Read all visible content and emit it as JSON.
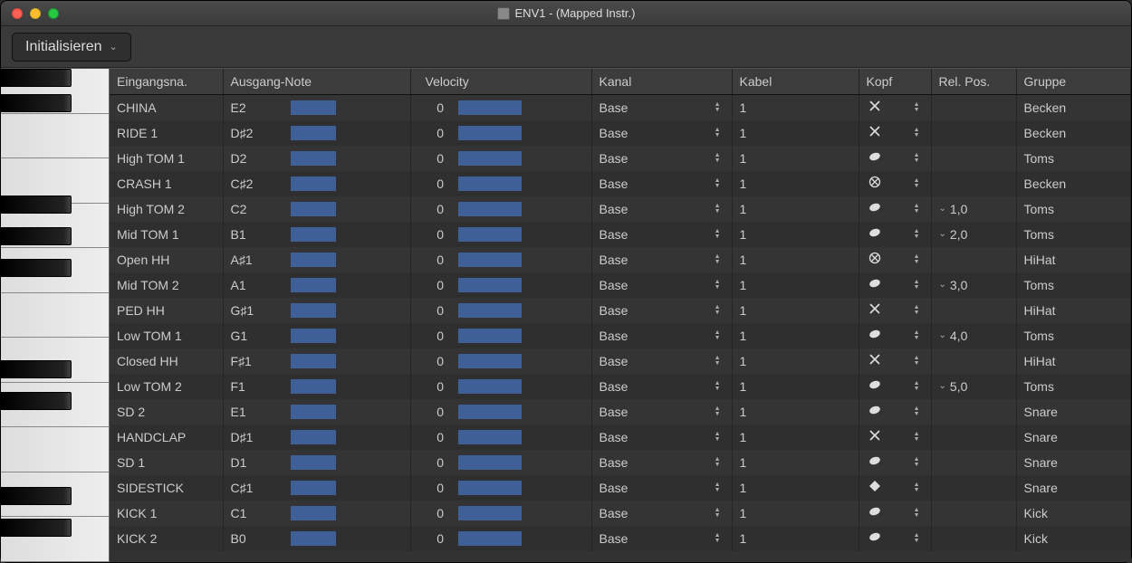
{
  "window": {
    "title": "ENV1 - (Mapped Instr.)"
  },
  "toolbar": {
    "init_label": "Initialisieren"
  },
  "columns": {
    "name": "Eingangsna.",
    "outnote": "Ausgang-Note",
    "velocity": "Velocity",
    "kanal": "Kanal",
    "kabel": "Kabel",
    "kopf": "Kopf",
    "relpos": "Rel. Pos.",
    "gruppe": "Gruppe"
  },
  "rows": [
    {
      "name": "CHINA",
      "note": "E2",
      "vel": "0",
      "kanal": "Base",
      "kabel": "1",
      "kopf": "x",
      "rel": "",
      "gruppe": "Becken"
    },
    {
      "name": "RIDE 1",
      "note": "D♯2",
      "vel": "0",
      "kanal": "Base",
      "kabel": "1",
      "kopf": "x",
      "rel": "",
      "gruppe": "Becken"
    },
    {
      "name": "High TOM 1",
      "note": "D2",
      "vel": "0",
      "kanal": "Base",
      "kabel": "1",
      "kopf": "oval",
      "rel": "",
      "gruppe": "Toms"
    },
    {
      "name": "CRASH 1",
      "note": "C♯2",
      "vel": "0",
      "kanal": "Base",
      "kabel": "1",
      "kopf": "xcircle",
      "rel": "",
      "gruppe": "Becken"
    },
    {
      "name": "High TOM 2",
      "note": "C2",
      "vel": "0",
      "kanal": "Base",
      "kabel": "1",
      "kopf": "oval",
      "rel": "1,0",
      "gruppe": "Toms"
    },
    {
      "name": "Mid TOM 1",
      "note": "B1",
      "vel": "0",
      "kanal": "Base",
      "kabel": "1",
      "kopf": "oval",
      "rel": "2,0",
      "gruppe": "Toms"
    },
    {
      "name": "Open HH",
      "note": "A♯1",
      "vel": "0",
      "kanal": "Base",
      "kabel": "1",
      "kopf": "xcircle",
      "rel": "",
      "gruppe": "HiHat"
    },
    {
      "name": "Mid TOM 2",
      "note": "A1",
      "vel": "0",
      "kanal": "Base",
      "kabel": "1",
      "kopf": "oval",
      "rel": "3,0",
      "gruppe": "Toms"
    },
    {
      "name": "PED HH",
      "note": "G♯1",
      "vel": "0",
      "kanal": "Base",
      "kabel": "1",
      "kopf": "x",
      "rel": "",
      "gruppe": "HiHat"
    },
    {
      "name": "Low TOM 1",
      "note": "G1",
      "vel": "0",
      "kanal": "Base",
      "kabel": "1",
      "kopf": "oval",
      "rel": "4,0",
      "gruppe": "Toms"
    },
    {
      "name": "Closed HH",
      "note": "F♯1",
      "vel": "0",
      "kanal": "Base",
      "kabel": "1",
      "kopf": "x",
      "rel": "",
      "gruppe": "HiHat"
    },
    {
      "name": "Low TOM 2",
      "note": "F1",
      "vel": "0",
      "kanal": "Base",
      "kabel": "1",
      "kopf": "oval",
      "rel": "5,0",
      "gruppe": "Toms"
    },
    {
      "name": "SD 2",
      "note": "E1",
      "vel": "0",
      "kanal": "Base",
      "kabel": "1",
      "kopf": "oval",
      "rel": "",
      "gruppe": "Snare"
    },
    {
      "name": "HANDCLAP",
      "note": "D♯1",
      "vel": "0",
      "kanal": "Base",
      "kabel": "1",
      "kopf": "x",
      "rel": "",
      "gruppe": "Snare"
    },
    {
      "name": "SD 1",
      "note": "D1",
      "vel": "0",
      "kanal": "Base",
      "kabel": "1",
      "kopf": "oval",
      "rel": "",
      "gruppe": "Snare"
    },
    {
      "name": "SIDESTICK",
      "note": "C♯1",
      "vel": "0",
      "kanal": "Base",
      "kabel": "1",
      "kopf": "diamond",
      "rel": "",
      "gruppe": "Snare"
    },
    {
      "name": "KICK 1",
      "note": "C1",
      "vel": "0",
      "kanal": "Base",
      "kabel": "1",
      "kopf": "oval",
      "rel": "",
      "gruppe": "Kick"
    },
    {
      "name": "KICK 2",
      "note": "B0",
      "vel": "0",
      "kanal": "Base",
      "kabel": "1",
      "kopf": "oval",
      "rel": "",
      "gruppe": "Kick"
    }
  ],
  "piano": {
    "white_count": 11,
    "black_offsets": [
      0,
      28,
      140,
      175,
      210,
      322,
      357,
      462,
      497
    ]
  }
}
